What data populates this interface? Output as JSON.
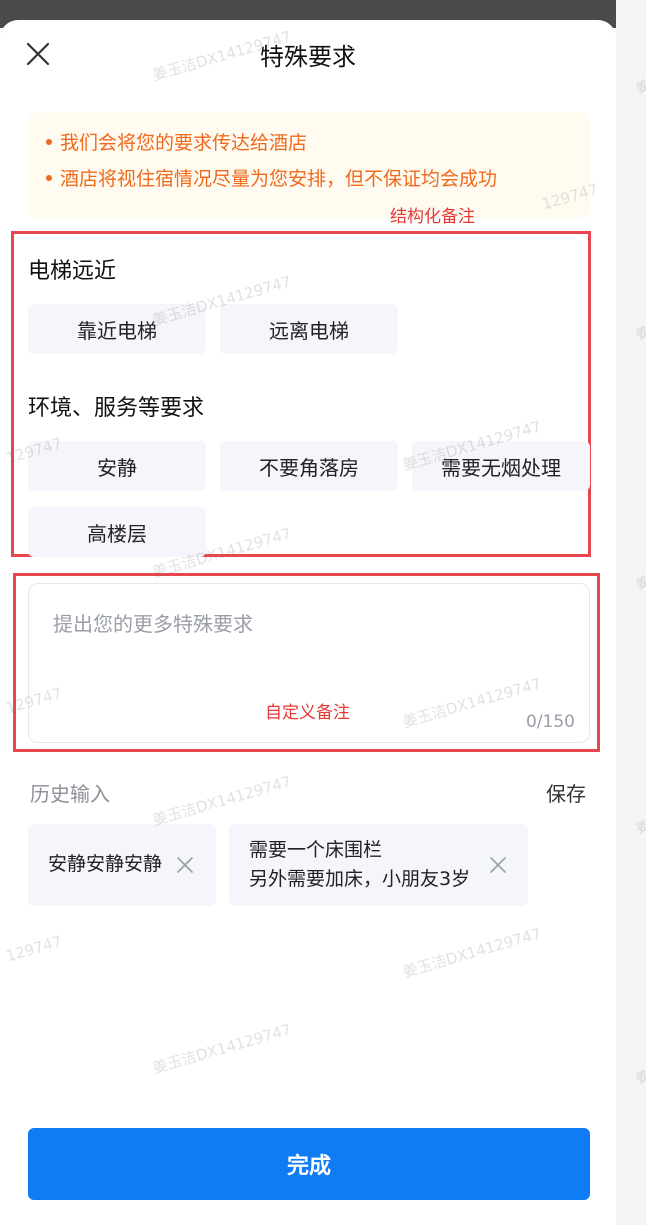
{
  "title": "特殊要求",
  "notice": [
    "我们会将您的要求传达给酒店",
    "酒店将视住宿情况尽量为您安排，但不保证均会成功"
  ],
  "annotations": {
    "structured": "结构化备注",
    "custom": "自定义备注"
  },
  "sections": [
    {
      "heading": "电梯远近",
      "options": [
        "靠近电梯",
        "远离电梯"
      ]
    },
    {
      "heading": "环境、服务等要求",
      "options": [
        "安静",
        "不要角落房",
        "需要无烟处理",
        "高楼层"
      ]
    }
  ],
  "remark": {
    "placeholder": "提出您的更多特殊要求",
    "value": "",
    "counter": "0/150"
  },
  "history": {
    "label": "历史输入",
    "save_label": "保存",
    "items": [
      "安静安静安静",
      "需要一个床围栏\n另外需要加床，小朋友3岁"
    ]
  },
  "done_label": "完成",
  "watermark": "姜玉洁DX14129747",
  "watermark_fragments": [
    "129747",
    "姜"
  ],
  "colors": {
    "primary": "#0f7cf6",
    "notice_text": "#f06a1d",
    "annotation": "#e53935"
  }
}
